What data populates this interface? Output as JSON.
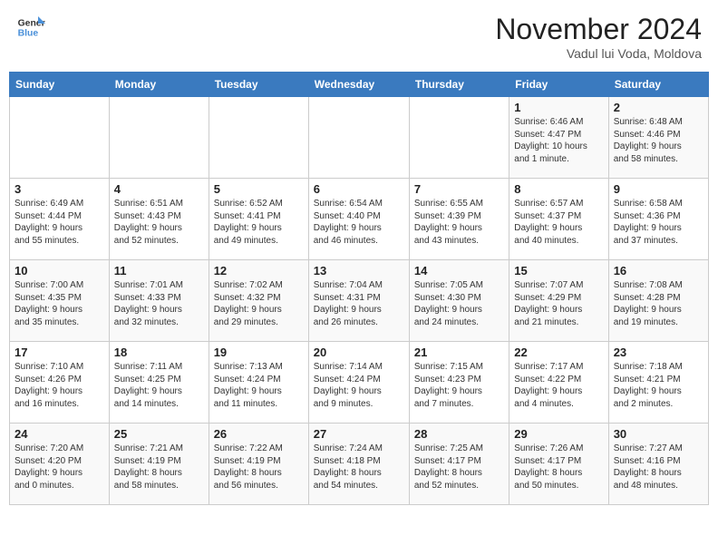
{
  "header": {
    "logo_line1": "General",
    "logo_line2": "Blue",
    "month": "November 2024",
    "location": "Vadul lui Voda, Moldova"
  },
  "weekdays": [
    "Sunday",
    "Monday",
    "Tuesday",
    "Wednesday",
    "Thursday",
    "Friday",
    "Saturday"
  ],
  "weeks": [
    [
      {
        "day": "",
        "info": ""
      },
      {
        "day": "",
        "info": ""
      },
      {
        "day": "",
        "info": ""
      },
      {
        "day": "",
        "info": ""
      },
      {
        "day": "",
        "info": ""
      },
      {
        "day": "1",
        "info": "Sunrise: 6:46 AM\nSunset: 4:47 PM\nDaylight: 10 hours\nand 1 minute."
      },
      {
        "day": "2",
        "info": "Sunrise: 6:48 AM\nSunset: 4:46 PM\nDaylight: 9 hours\nand 58 minutes."
      }
    ],
    [
      {
        "day": "3",
        "info": "Sunrise: 6:49 AM\nSunset: 4:44 PM\nDaylight: 9 hours\nand 55 minutes."
      },
      {
        "day": "4",
        "info": "Sunrise: 6:51 AM\nSunset: 4:43 PM\nDaylight: 9 hours\nand 52 minutes."
      },
      {
        "day": "5",
        "info": "Sunrise: 6:52 AM\nSunset: 4:41 PM\nDaylight: 9 hours\nand 49 minutes."
      },
      {
        "day": "6",
        "info": "Sunrise: 6:54 AM\nSunset: 4:40 PM\nDaylight: 9 hours\nand 46 minutes."
      },
      {
        "day": "7",
        "info": "Sunrise: 6:55 AM\nSunset: 4:39 PM\nDaylight: 9 hours\nand 43 minutes."
      },
      {
        "day": "8",
        "info": "Sunrise: 6:57 AM\nSunset: 4:37 PM\nDaylight: 9 hours\nand 40 minutes."
      },
      {
        "day": "9",
        "info": "Sunrise: 6:58 AM\nSunset: 4:36 PM\nDaylight: 9 hours\nand 37 minutes."
      }
    ],
    [
      {
        "day": "10",
        "info": "Sunrise: 7:00 AM\nSunset: 4:35 PM\nDaylight: 9 hours\nand 35 minutes."
      },
      {
        "day": "11",
        "info": "Sunrise: 7:01 AM\nSunset: 4:33 PM\nDaylight: 9 hours\nand 32 minutes."
      },
      {
        "day": "12",
        "info": "Sunrise: 7:02 AM\nSunset: 4:32 PM\nDaylight: 9 hours\nand 29 minutes."
      },
      {
        "day": "13",
        "info": "Sunrise: 7:04 AM\nSunset: 4:31 PM\nDaylight: 9 hours\nand 26 minutes."
      },
      {
        "day": "14",
        "info": "Sunrise: 7:05 AM\nSunset: 4:30 PM\nDaylight: 9 hours\nand 24 minutes."
      },
      {
        "day": "15",
        "info": "Sunrise: 7:07 AM\nSunset: 4:29 PM\nDaylight: 9 hours\nand 21 minutes."
      },
      {
        "day": "16",
        "info": "Sunrise: 7:08 AM\nSunset: 4:28 PM\nDaylight: 9 hours\nand 19 minutes."
      }
    ],
    [
      {
        "day": "17",
        "info": "Sunrise: 7:10 AM\nSunset: 4:26 PM\nDaylight: 9 hours\nand 16 minutes."
      },
      {
        "day": "18",
        "info": "Sunrise: 7:11 AM\nSunset: 4:25 PM\nDaylight: 9 hours\nand 14 minutes."
      },
      {
        "day": "19",
        "info": "Sunrise: 7:13 AM\nSunset: 4:24 PM\nDaylight: 9 hours\nand 11 minutes."
      },
      {
        "day": "20",
        "info": "Sunrise: 7:14 AM\nSunset: 4:24 PM\nDaylight: 9 hours\nand 9 minutes."
      },
      {
        "day": "21",
        "info": "Sunrise: 7:15 AM\nSunset: 4:23 PM\nDaylight: 9 hours\nand 7 minutes."
      },
      {
        "day": "22",
        "info": "Sunrise: 7:17 AM\nSunset: 4:22 PM\nDaylight: 9 hours\nand 4 minutes."
      },
      {
        "day": "23",
        "info": "Sunrise: 7:18 AM\nSunset: 4:21 PM\nDaylight: 9 hours\nand 2 minutes."
      }
    ],
    [
      {
        "day": "24",
        "info": "Sunrise: 7:20 AM\nSunset: 4:20 PM\nDaylight: 9 hours\nand 0 minutes."
      },
      {
        "day": "25",
        "info": "Sunrise: 7:21 AM\nSunset: 4:19 PM\nDaylight: 8 hours\nand 58 minutes."
      },
      {
        "day": "26",
        "info": "Sunrise: 7:22 AM\nSunset: 4:19 PM\nDaylight: 8 hours\nand 56 minutes."
      },
      {
        "day": "27",
        "info": "Sunrise: 7:24 AM\nSunset: 4:18 PM\nDaylight: 8 hours\nand 54 minutes."
      },
      {
        "day": "28",
        "info": "Sunrise: 7:25 AM\nSunset: 4:17 PM\nDaylight: 8 hours\nand 52 minutes."
      },
      {
        "day": "29",
        "info": "Sunrise: 7:26 AM\nSunset: 4:17 PM\nDaylight: 8 hours\nand 50 minutes."
      },
      {
        "day": "30",
        "info": "Sunrise: 7:27 AM\nSunset: 4:16 PM\nDaylight: 8 hours\nand 48 minutes."
      }
    ]
  ]
}
